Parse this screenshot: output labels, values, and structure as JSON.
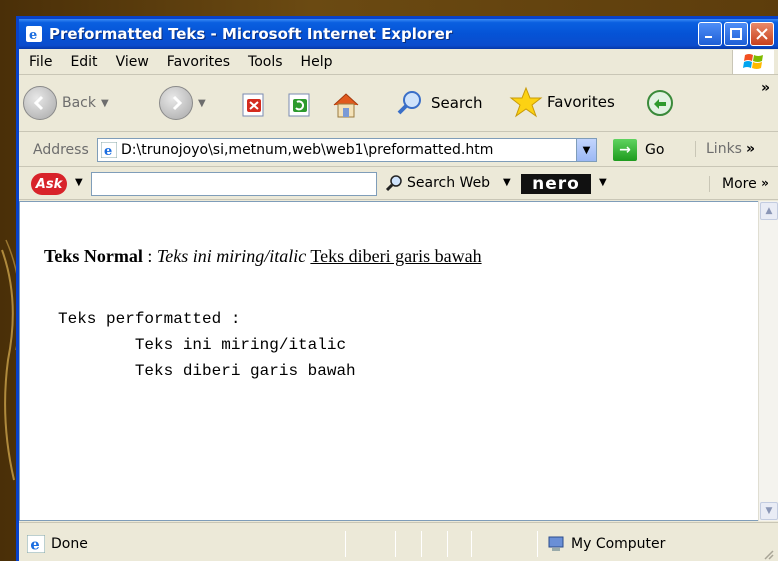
{
  "window": {
    "title": "Preformatted Teks - Microsoft Internet Explorer"
  },
  "menu": {
    "items": [
      "File",
      "Edit",
      "View",
      "Favorites",
      "Tools",
      "Help"
    ]
  },
  "toolbar": {
    "back_label": "Back",
    "search_label": "Search",
    "favorites_label": "Favorites"
  },
  "address": {
    "label": "Address",
    "url": "D:\\trunojoyo\\si,metnum,web\\web1\\preformatted.htm",
    "go_label": "Go",
    "links_label": "Links"
  },
  "askbar": {
    "logo": "Ask",
    "search_placeholder": "",
    "search_web_label": "Search Web",
    "nero_label": "nero",
    "more_label": "More"
  },
  "page": {
    "normal_bold": "Teks Normal",
    "normal_sep": " : ",
    "normal_italic": "Teks ini miring/italic",
    "normal_underline": "Teks diberi garis bawah",
    "pre_lines": [
      "Teks performatted :",
      "        Teks ini miring/italic",
      "        Teks diberi garis bawah"
    ]
  },
  "status": {
    "text": "Done",
    "zone": "My Computer"
  },
  "colors": {
    "titlebar": "#0553d6",
    "slide_bg": "#5a3a0a",
    "window_chrome": "#ece9d8"
  }
}
